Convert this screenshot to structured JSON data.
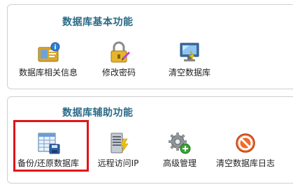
{
  "basic": {
    "title": "数据库基本功能",
    "items": [
      {
        "label": "数据库相关信息",
        "icon": "id-card-icon"
      },
      {
        "label": "修改密码",
        "icon": "lock-pencil-icon"
      },
      {
        "label": "清空数据库",
        "icon": "monitor-icon"
      }
    ]
  },
  "aux": {
    "title": "数据库辅助功能",
    "items": [
      {
        "label": "备份/还原数据库",
        "icon": "spreadsheet-disk-icon"
      },
      {
        "label": "远程访问IP",
        "icon": "server-lightning-icon"
      },
      {
        "label": "高级管理",
        "icon": "gear-plus-icon"
      },
      {
        "label": "清空数据库日志",
        "icon": "no-entry-icon"
      }
    ]
  },
  "colors": {
    "title": "#2a6a86",
    "highlight": "#e0141b",
    "panel_border": "#cfcfcf"
  }
}
